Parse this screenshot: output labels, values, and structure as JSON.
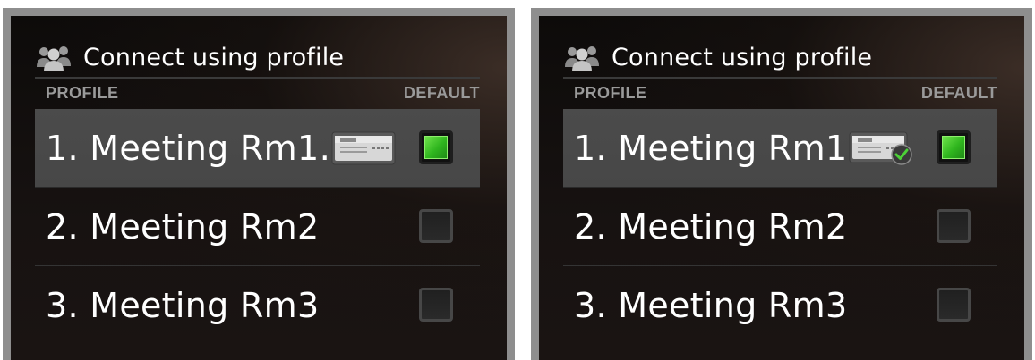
{
  "panels": [
    {
      "header": {
        "icon": "people-icon",
        "title": "Connect using profile"
      },
      "columns": {
        "profile": "PROFILE",
        "default": "DEFAULT"
      },
      "rows": [
        {
          "label": "1. Meeting Rm1…",
          "selected": true,
          "device": "amx-device-icon",
          "device_connected": false,
          "default": true
        },
        {
          "label": "2. Meeting Rm2",
          "selected": false,
          "default": false
        },
        {
          "label": "3. Meeting Rm3",
          "selected": false,
          "default": false
        }
      ]
    },
    {
      "header": {
        "icon": "people-icon",
        "title": "Connect using profile"
      },
      "columns": {
        "profile": "PROFILE",
        "default": "DEFAULT"
      },
      "rows": [
        {
          "label": "1. Meeting Rm1…",
          "selected": true,
          "device": "amx-device-icon",
          "device_connected": true,
          "default": true
        },
        {
          "label": "2. Meeting Rm2",
          "selected": false,
          "default": false
        },
        {
          "label": "3. Meeting Rm3",
          "selected": false,
          "default": false
        }
      ]
    }
  ],
  "colors": {
    "checked_green": "#3fcf2a",
    "connected_green": "#4cd137",
    "selected_row": "#494949"
  }
}
